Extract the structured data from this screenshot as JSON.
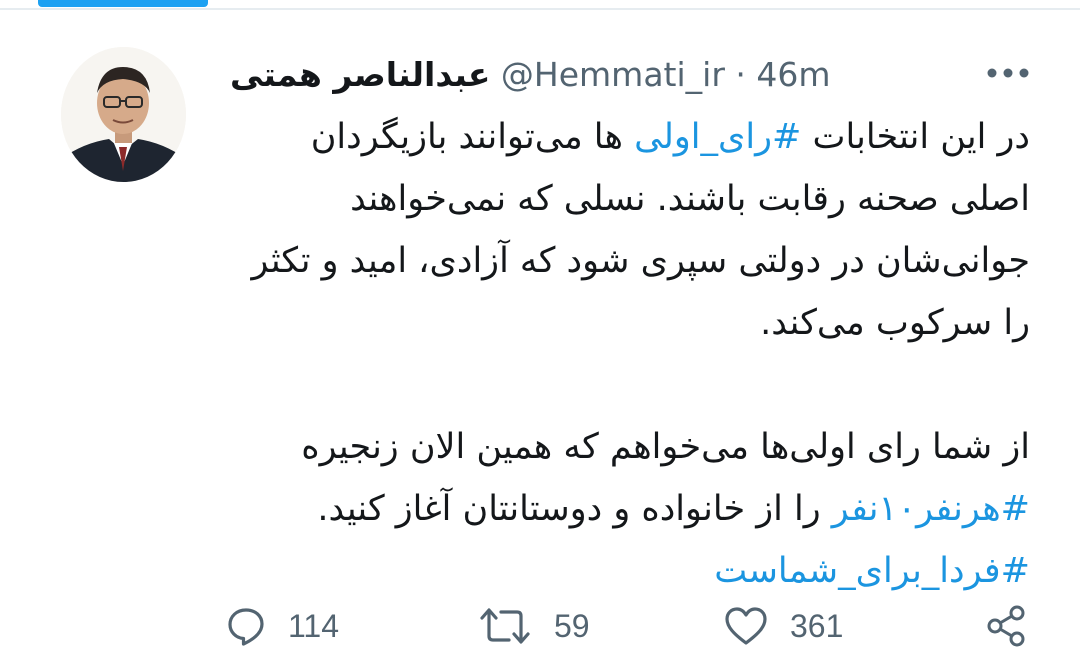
{
  "colors": {
    "accent": "#1b95e0",
    "muted": "#536471",
    "text": "#14171a"
  },
  "tweet": {
    "author": {
      "name": "عبدالناصر همتی",
      "handle": "@Hemmati_ir",
      "separator": "·",
      "time": "46m",
      "avatar_icon": "profile-photo"
    },
    "more_icon": "more-dots-icon",
    "body": {
      "line1_pre": "در این انتخابات ",
      "line1_tag": "#رای_اولی",
      "line1_post": " ها می‌توانند بازیگردان",
      "line2": "اصلی صحنه رقابت باشند. نسلی که نمی‌خواهند",
      "line3": "جوانی‌شان در دولتی سپری شود که آزادی، امید و تکثر",
      "line4": "را سرکوب می‌کند.",
      "line5": "از شما رای اولی‌ها می‌خواهم که همین الان زنجیره",
      "line6_tag": "#هرنفر۱۰نفر",
      "line6_post": " را از خانواده و دوستانتان آغاز کنید.",
      "line7_tag": "#فردا_برای_شماست"
    },
    "actions": {
      "reply": {
        "icon": "reply-icon",
        "count": "114"
      },
      "retweet": {
        "icon": "retweet-icon",
        "count": "59"
      },
      "like": {
        "icon": "heart-icon",
        "count": "361"
      },
      "share": {
        "icon": "share-icon"
      }
    }
  }
}
